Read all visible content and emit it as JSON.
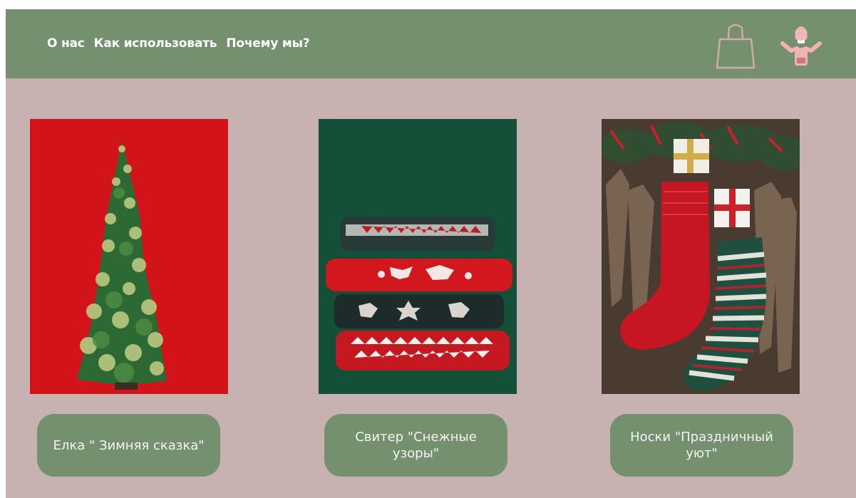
{
  "header": {
    "nav": [
      "О нас",
      "Как использовать",
      "Почему мы?"
    ],
    "icons": [
      "shopping-bag-icon",
      "user-shopper-icon"
    ]
  },
  "products": [
    {
      "label": "Елка \" Зимняя сказка\"",
      "image": "christmas-tree-photo"
    },
    {
      "label": "Свитер \"Снежные узоры\"",
      "image": "sweater-stack-photo"
    },
    {
      "label": "Носки \"Праздничный уют\"",
      "image": "christmas-socks-photo"
    }
  ],
  "colors": {
    "header": "#75906f",
    "background": "#c8b1b1",
    "button": "#75906f",
    "icon_accent": "#e7b3ae"
  }
}
